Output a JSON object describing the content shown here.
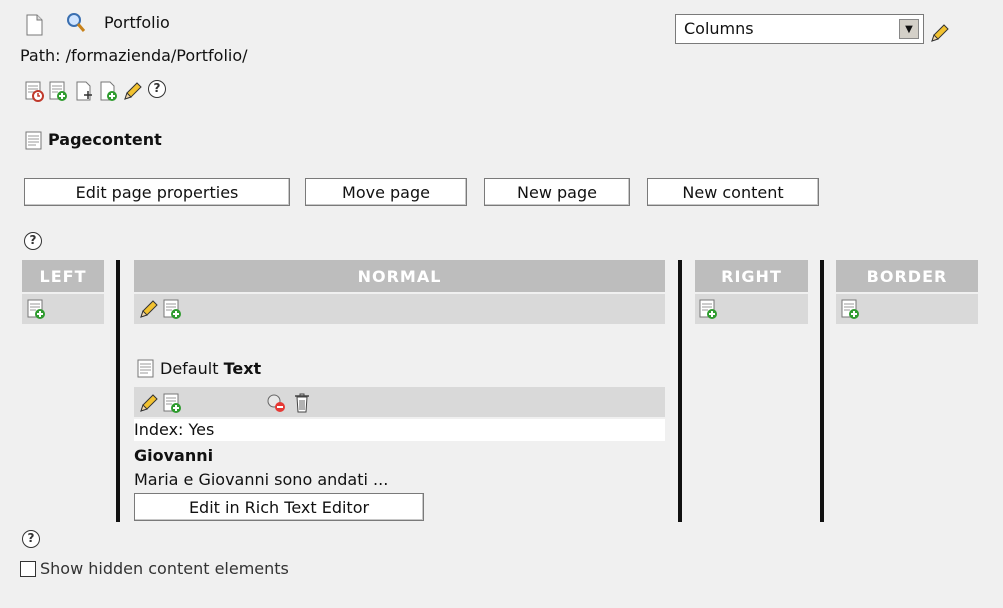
{
  "header": {
    "title": "Portfolio",
    "path": "Path: /formazienda/Portfolio/"
  },
  "layout_select": {
    "value": "Columns"
  },
  "section": {
    "title": "Pagecontent"
  },
  "buttons": {
    "edit_page_properties": "Edit page properties",
    "move_page": "Move page",
    "new_page": "New page",
    "new_content": "New content",
    "edit_rte": "Edit in Rich Text Editor"
  },
  "columns": {
    "left": "LEFT",
    "normal": "NORMAL",
    "right": "RIGHT",
    "border": "BORDER"
  },
  "content_element": {
    "type_prefix": "Default",
    "type_name": "Text",
    "index": "Index: Yes",
    "header": "Giovanni",
    "bodytext": "Maria e Giovanni sono andati ..."
  },
  "help_symbol": "?",
  "show_hidden": {
    "label": "Show hidden content elements",
    "checked": false
  },
  "colors": {
    "background": "#f0f0f0",
    "column_header": "#bdbdbd",
    "column_bar": "#d9d9d9"
  }
}
